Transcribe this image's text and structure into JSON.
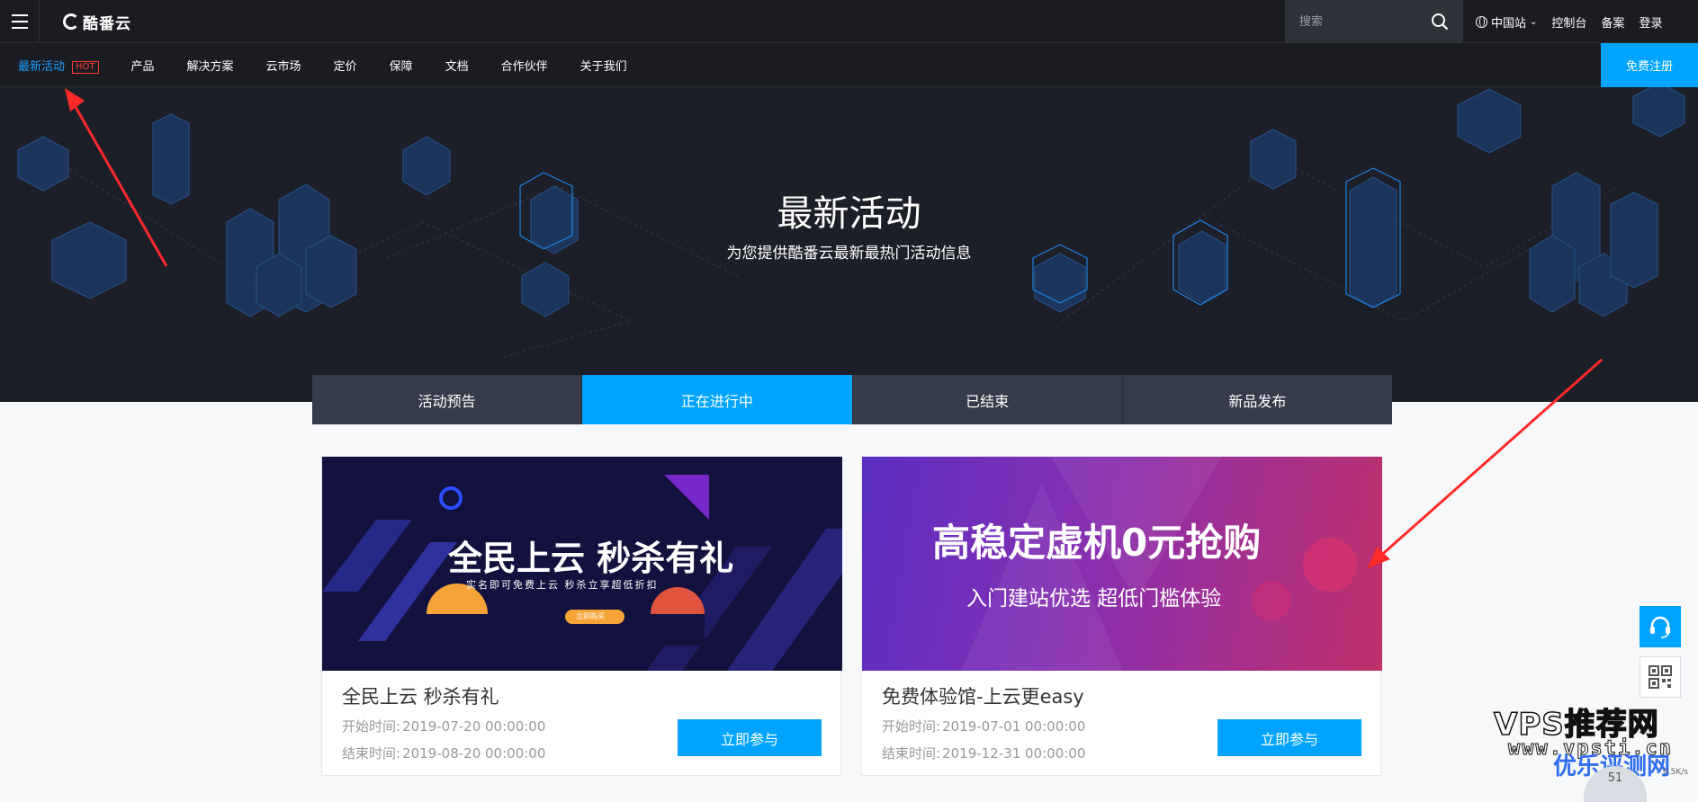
{
  "header": {
    "logo_text": "酷番云",
    "search_placeholder": "搜索",
    "region": "中国站",
    "links": [
      "控制台",
      "备案",
      "登录"
    ]
  },
  "nav": {
    "items": [
      "最新活动",
      "产品",
      "解决方案",
      "云市场",
      "定价",
      "保障",
      "文档",
      "合作伙伴",
      "关于我们"
    ],
    "hot_badge": "HOT",
    "register_label": "免费注册"
  },
  "hero": {
    "title": "最新活动",
    "subtitle": "为您提供酷番云最新最热门活动信息"
  },
  "tabs": {
    "items": [
      "活动预告",
      "正在进行中",
      "已结束",
      "新品发布"
    ],
    "active_index": 1
  },
  "cards": [
    {
      "banner_title": "全民上云  秒杀有礼",
      "banner_sub": "实名即可免费上云   秒杀立享超低折扣",
      "banner_btn": "立即购买",
      "title": "全民上云 秒杀有礼",
      "start_label": "开始时间:",
      "start": "2019-07-20 00:00:00",
      "end_label": "结束时间:",
      "end": "2019-08-20 00:00:00",
      "button": "立即参与"
    },
    {
      "banner_title": "高稳定虚机0元抢购",
      "banner_sub": "入门建站优选 超低门槛体验",
      "title": "免费体验馆-上云更easy",
      "start_label": "开始时间:",
      "start": "2019-07-01 00:00:00",
      "end_label": "结束时间:",
      "end": "2019-12-31 00:00:00",
      "button": "立即参与"
    }
  ],
  "watermark": {
    "line1": "VPS推荐网",
    "line2": "www.vpsti.cn",
    "line3": "优乐评测网"
  },
  "speed_widget": {
    "value": "51",
    "unit": "0.5K/s"
  },
  "colors": {
    "accent": "#00a4ff",
    "hot": "#ff3b30",
    "header_bg": "#1b1c22",
    "hero_bg": "#1c1f27",
    "tab_bg": "#353b48"
  },
  "icons": [
    "menu-icon",
    "search-icon",
    "globe-icon",
    "chevron-down-icon",
    "headset-icon",
    "qrcode-icon"
  ]
}
